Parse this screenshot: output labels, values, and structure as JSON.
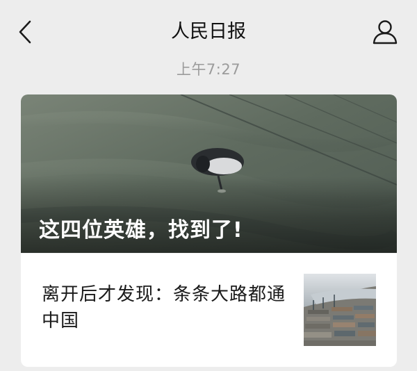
{
  "header": {
    "title": "人民日报",
    "back_icon": "chevron-left-icon",
    "profile_icon": "person-icon"
  },
  "message": {
    "time": "上午7:27"
  },
  "articles": {
    "main": {
      "title": "这四位英雄，找到了!"
    },
    "secondary": {
      "title": "离开后才发现：条条大路都通中国"
    }
  },
  "colors": {
    "background": "#ededed",
    "card": "#ffffff",
    "time_text": "#9b9b9b",
    "water": "#5e6b5f"
  }
}
